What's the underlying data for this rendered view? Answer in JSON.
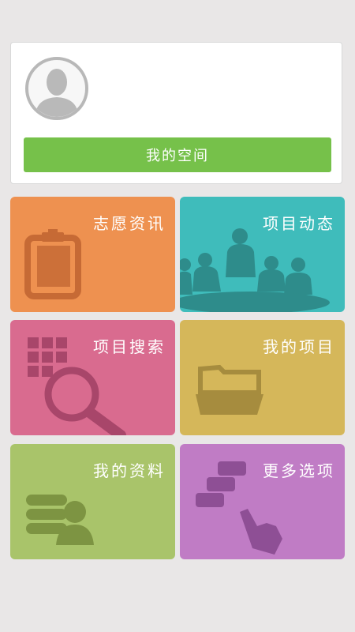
{
  "profile": {
    "button_label": "我的空间",
    "button_color": "#76c14a"
  },
  "tiles": [
    {
      "label": "志愿资讯",
      "color": "#ee9150",
      "icon": "clipboard-icon"
    },
    {
      "label": "项目动态",
      "color": "#3fbcbb",
      "icon": "team-meeting-icon"
    },
    {
      "label": "项目搜索",
      "color": "#d96b8f",
      "icon": "search-grid-icon"
    },
    {
      "label": "我的项目",
      "color": "#d5b75a",
      "icon": "folder-icon"
    },
    {
      "label": "我的资料",
      "color": "#a9c46a",
      "icon": "profile-data-icon"
    },
    {
      "label": "更多选项",
      "color": "#c07cc5",
      "icon": "hand-pointer-icon"
    }
  ]
}
